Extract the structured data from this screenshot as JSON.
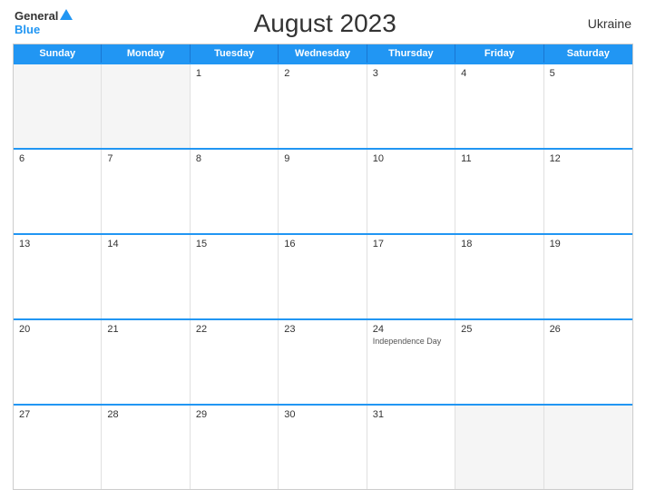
{
  "header": {
    "title": "August 2023",
    "country": "Ukraine",
    "logo_general": "General",
    "logo_blue": "Blue"
  },
  "days_of_week": [
    "Sunday",
    "Monday",
    "Tuesday",
    "Wednesday",
    "Thursday",
    "Friday",
    "Saturday"
  ],
  "weeks": [
    [
      {
        "day": "",
        "empty": true
      },
      {
        "day": "",
        "empty": true
      },
      {
        "day": "1",
        "empty": false
      },
      {
        "day": "2",
        "empty": false
      },
      {
        "day": "3",
        "empty": false
      },
      {
        "day": "4",
        "empty": false
      },
      {
        "day": "5",
        "empty": false
      }
    ],
    [
      {
        "day": "6",
        "empty": false
      },
      {
        "day": "7",
        "empty": false
      },
      {
        "day": "8",
        "empty": false
      },
      {
        "day": "9",
        "empty": false
      },
      {
        "day": "10",
        "empty": false
      },
      {
        "day": "11",
        "empty": false
      },
      {
        "day": "12",
        "empty": false
      }
    ],
    [
      {
        "day": "13",
        "empty": false
      },
      {
        "day": "14",
        "empty": false
      },
      {
        "day": "15",
        "empty": false
      },
      {
        "day": "16",
        "empty": false
      },
      {
        "day": "17",
        "empty": false
      },
      {
        "day": "18",
        "empty": false
      },
      {
        "day": "19",
        "empty": false
      }
    ],
    [
      {
        "day": "20",
        "empty": false
      },
      {
        "day": "21",
        "empty": false
      },
      {
        "day": "22",
        "empty": false
      },
      {
        "day": "23",
        "empty": false
      },
      {
        "day": "24",
        "empty": false,
        "holiday": "Independence Day"
      },
      {
        "day": "25",
        "empty": false
      },
      {
        "day": "26",
        "empty": false
      }
    ],
    [
      {
        "day": "27",
        "empty": false
      },
      {
        "day": "28",
        "empty": false
      },
      {
        "day": "29",
        "empty": false
      },
      {
        "day": "30",
        "empty": false
      },
      {
        "day": "31",
        "empty": false
      },
      {
        "day": "",
        "empty": true
      },
      {
        "day": "",
        "empty": true
      }
    ]
  ]
}
